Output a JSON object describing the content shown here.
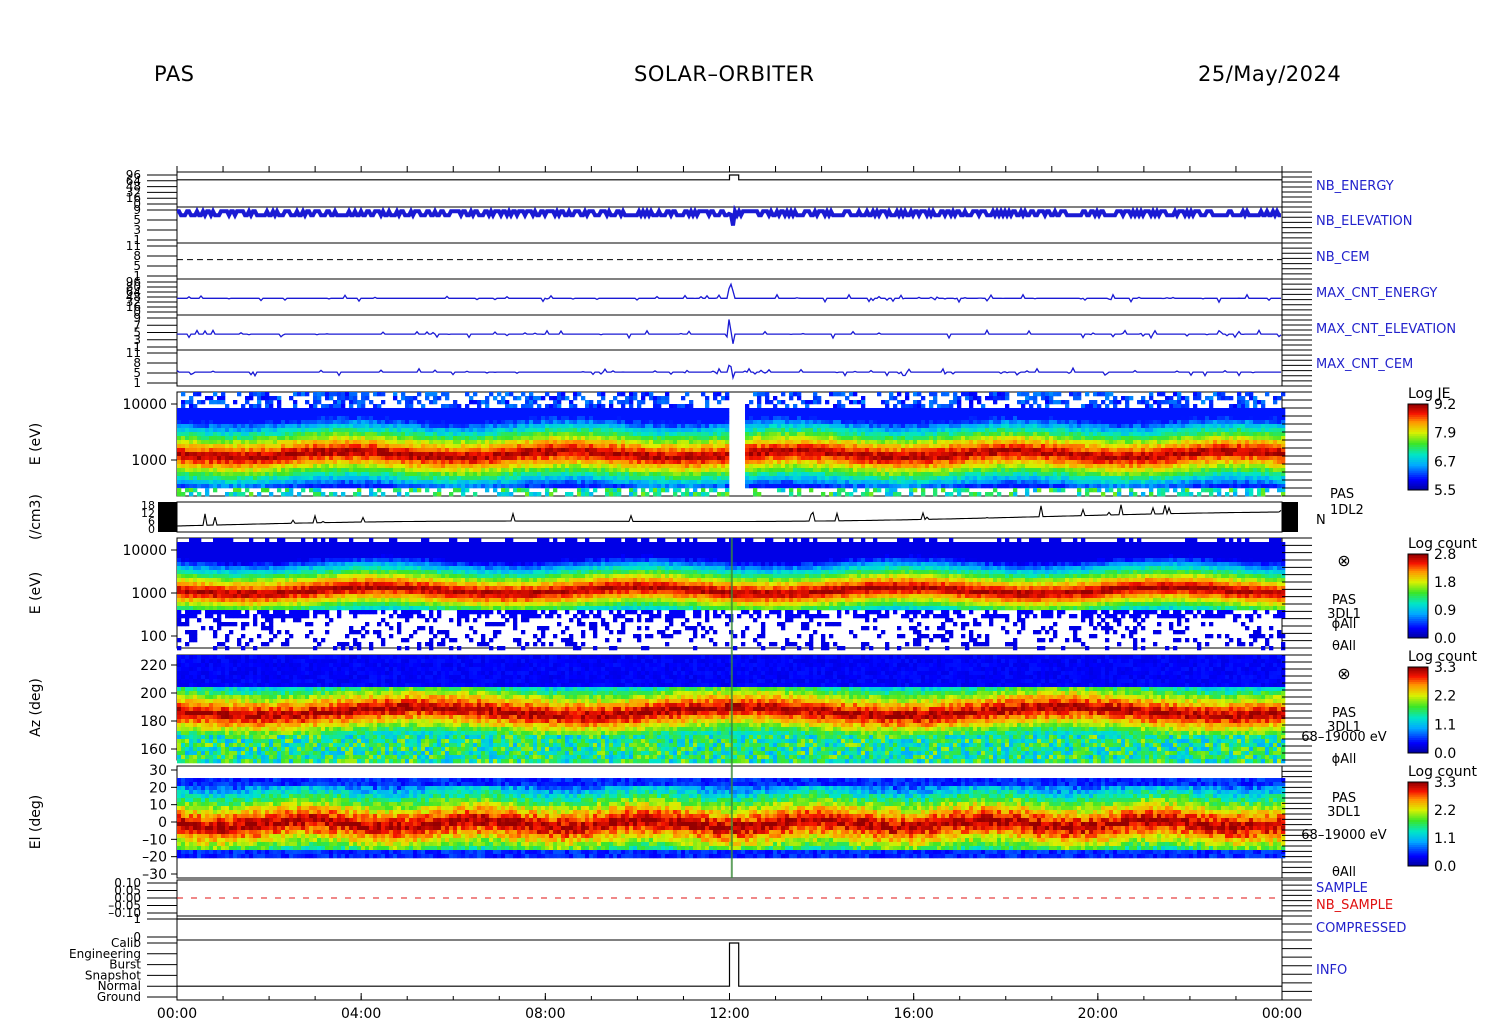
{
  "header": {
    "left": "PAS",
    "center": "SOLAR–ORBITER",
    "right": "25/May/2024"
  },
  "colors": {
    "line_blue": "#1a1ad4",
    "sample_red": "#e01010",
    "label_blue": "#2222cc"
  },
  "time_ticks": [
    "00:00",
    "04:00",
    "08:00",
    "12:00",
    "16:00",
    "20:00",
    "00:00"
  ],
  "chart_data": [
    {
      "type": "line",
      "name": "nb_energy",
      "right_label": "NB_ENERGY",
      "yticks": [
        "96",
        "64",
        "48",
        "32",
        "16",
        "0"
      ],
      "x_hours": [
        0,
        12.0,
        12.0,
        12.2,
        12.2,
        24
      ],
      "values": [
        80,
        80,
        96,
        96,
        80,
        80
      ]
    },
    {
      "type": "line",
      "name": "nb_elevation",
      "right_label": "NB_ELEVATION",
      "yticks": [
        "9",
        "5",
        "3",
        "1"
      ],
      "baseline": 8,
      "note": "rapid oscillation 7-9"
    },
    {
      "type": "line",
      "name": "nb_cem",
      "right_label": "NB_CEM",
      "yticks": [
        "11",
        "8",
        "5",
        "1"
      ],
      "constant": 6
    },
    {
      "type": "line",
      "name": "max_cnt_energy",
      "right_label": "MAX_CNT_ENERGY",
      "yticks": [
        "96",
        "80",
        "64",
        "48",
        "32",
        "16",
        "0"
      ],
      "baseline": 44
    },
    {
      "type": "line",
      "name": "max_cnt_elevation",
      "right_label": "MAX_CNT_ELEVATION",
      "yticks": [
        "9",
        "7",
        "5",
        "3",
        "1"
      ],
      "baseline": 4
    },
    {
      "type": "line",
      "name": "max_cnt_cem",
      "right_label": "MAX_CNT_CEM",
      "yticks": [
        "11",
        "8",
        "5",
        "1"
      ],
      "baseline": 4
    },
    {
      "type": "heatmap",
      "name": "energy_spectrogram_1dl2",
      "ylabel": "E (eV)",
      "ylog": true,
      "yticks": [
        "10000",
        "1000"
      ],
      "colorbar": {
        "label": "Log JE",
        "ticks": [
          "9.2",
          "7.9",
          "6.7",
          "5.5"
        ]
      },
      "peak_energy_eV": 1300,
      "gap_x_hours": 12.1
    },
    {
      "type": "line",
      "name": "density",
      "ylabel": "(/cm3)",
      "yticks": [
        "18",
        "12",
        "6",
        "0"
      ],
      "right_label": [
        "PAS",
        "1DL2",
        "N"
      ],
      "baseline": 4
    },
    {
      "type": "heatmap",
      "name": "energy_spectrogram_3dl1",
      "ylabel": "E (eV)",
      "ylog": true,
      "yticks": [
        "10000",
        "1000",
        "100"
      ],
      "colorbar": {
        "label": "Log count",
        "ticks": [
          "2.8",
          "1.8",
          "0.9",
          "0.0"
        ]
      },
      "right_label": [
        "⊗",
        "PAS",
        "3DL1",
        "ϕAll",
        "θAll"
      ]
    },
    {
      "type": "heatmap",
      "name": "azimuth_spectrogram",
      "ylabel": "Az (deg)",
      "yticks": [
        "220",
        "200",
        "180",
        "160"
      ],
      "colorbar": {
        "label": "Log count",
        "ticks": [
          "3.3",
          "2.2",
          "1.1",
          "0.0"
        ]
      },
      "right_label": [
        "⊗",
        "PAS",
        "3DL1",
        "68–19000 eV",
        "ϕAll"
      ]
    },
    {
      "type": "heatmap",
      "name": "elevation_spectrogram",
      "ylabel": "El (deg)",
      "yticks": [
        "30",
        "20",
        "10",
        "0",
        "–10",
        "–20",
        "–30"
      ],
      "colorbar": {
        "label": "Log count",
        "ticks": [
          "3.3",
          "2.2",
          "1.1",
          "0.0"
        ]
      },
      "right_label": [
        "PAS",
        "3DL1",
        "68–19000 eV",
        "θAll"
      ]
    },
    {
      "type": "line",
      "name": "sample",
      "right_label": [
        "SAMPLE",
        "NB_SAMPLE"
      ],
      "yticks": [
        "0.10",
        "0.05",
        "0.00",
        "–0.05",
        "–0.10"
      ],
      "constant": 0.0
    },
    {
      "type": "line",
      "name": "compressed",
      "right_label": "COMPRESSED",
      "yticks": [
        "1",
        "0"
      ],
      "constant": 1
    },
    {
      "type": "line",
      "name": "info",
      "right_label": "INFO",
      "yticks": [
        "Calib",
        "Engineering",
        "Burst",
        "Snapshot",
        "Normal",
        "Ground"
      ],
      "x_hours": [
        0,
        12.0,
        12.0,
        12.2,
        12.2,
        24
      ],
      "values": [
        "Normal",
        "Normal",
        "Calib",
        "Calib",
        "Normal",
        "Normal"
      ]
    }
  ]
}
